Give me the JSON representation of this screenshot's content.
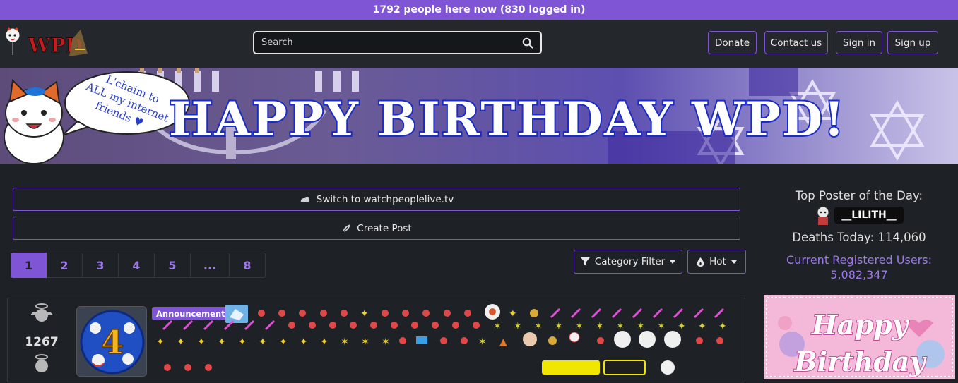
{
  "topbar": {
    "online_text": "1792 people here now (830 logged in)"
  },
  "header": {
    "search_placeholder": "Search",
    "buttons": {
      "donate": "Donate",
      "contact": "Contact us",
      "signin": "Sign in",
      "signup": "Sign up"
    }
  },
  "banner": {
    "title": "HAPPY BIRTHDAY WPD!",
    "bubble": [
      "L'chaim to",
      "ALL my internet",
      "friends ♥"
    ]
  },
  "actions": {
    "switch_label": "Switch to watchpeoplelive.tv",
    "create_label": "Create Post"
  },
  "pagination": {
    "pages": [
      "1",
      "2",
      "3",
      "4",
      "5",
      "...",
      "8"
    ],
    "active": "1"
  },
  "filters": {
    "category": "Category Filter",
    "sort": "Hot"
  },
  "sidebar": {
    "top_poster_label": "Top Poster of the Day:",
    "top_poster_name": "__LILITH__",
    "deaths_label": "Deaths Today: 114,060",
    "registered_label": "Current Registered Users:",
    "registered_value": "5,082,347",
    "card_title": [
      "Happy",
      "Birthday"
    ]
  },
  "post": {
    "score": "1267",
    "flair": "Announcements",
    "thumb_number": "4"
  },
  "colors": {
    "accent": "#7f55d6",
    "accent_light": "#9d79e9",
    "bg": "#1e2226",
    "nav_bg": "#24282d"
  }
}
